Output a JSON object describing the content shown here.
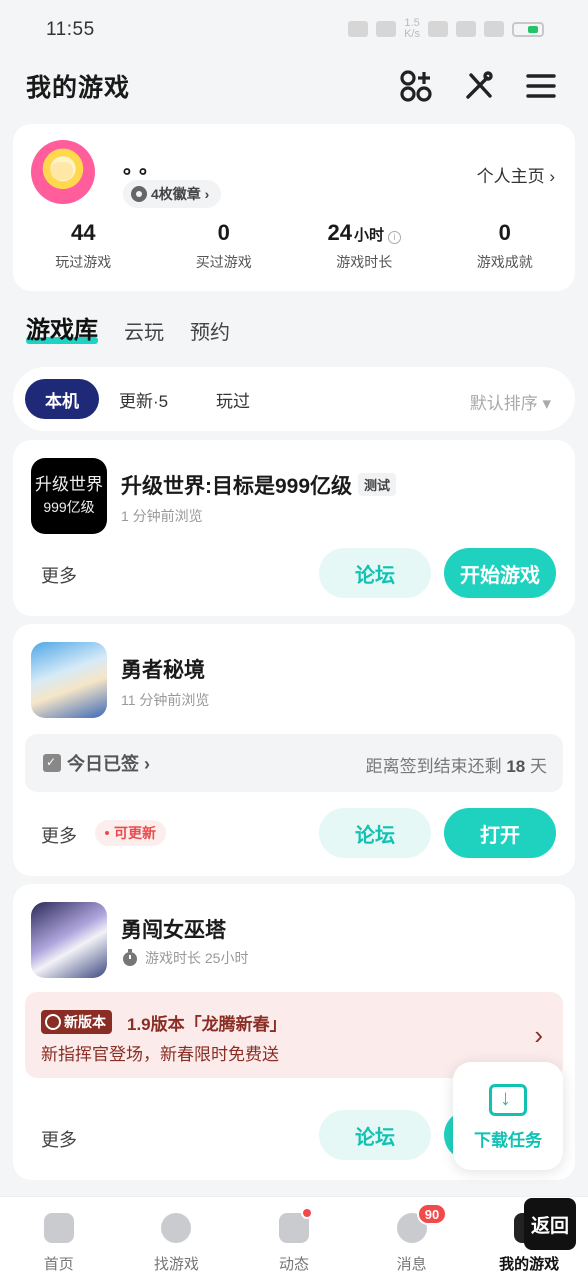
{
  "status": {
    "time": "11:55",
    "net_speed": "1.5\nK/s"
  },
  "header": {
    "title": "我的游戏"
  },
  "profile": {
    "nickname": "。。",
    "badges_label": "4枚徽章 ›",
    "home_link": "个人主页 ›",
    "stats": [
      {
        "value": "44",
        "unit": "",
        "label": "玩过游戏"
      },
      {
        "value": "0",
        "unit": "",
        "label": "买过游戏"
      },
      {
        "value": "24",
        "unit": "小时",
        "label": "游戏时长"
      },
      {
        "value": "0",
        "unit": "",
        "label": "游戏成就"
      }
    ]
  },
  "tabs": [
    "游戏库",
    "云玩",
    "预约"
  ],
  "filters": {
    "local": "本机",
    "update": "更新·5",
    "played": "玩过",
    "sort": "默认排序 ▾"
  },
  "games": [
    {
      "name": "升级世界:目标是999亿级",
      "tag": "测试",
      "icon_text_1": "升级世界",
      "icon_text_2": "999亿级",
      "sub": "1 分钟前浏览",
      "more": "更多",
      "forum": "论坛",
      "action": "开始游戏"
    },
    {
      "name": "勇者秘境",
      "sub": "11 分钟前浏览",
      "sign_left": "今日已签 ›",
      "sign_right_prefix": "距离签到结束还剩 ",
      "sign_right_days": "18",
      "sign_right_suffix": " 天",
      "more": "更多",
      "update_tag": "可更新",
      "forum": "论坛",
      "action": "打开"
    },
    {
      "name": "勇闯女巫塔",
      "sub": "游戏时长 25小时",
      "new_badge": "新版本",
      "new_title": "1.9版本「龙腾新春」",
      "new_desc": "新指挥官登场，新春限时免费送",
      "more": "更多",
      "forum": "论坛"
    }
  ],
  "float_download": {
    "label": "下载任务"
  },
  "bottom_nav": [
    {
      "label": "首页"
    },
    {
      "label": "找游戏"
    },
    {
      "label": "动态"
    },
    {
      "label": "消息",
      "count": "90"
    },
    {
      "label": "我的游戏"
    }
  ],
  "back_button": "返回",
  "colors": {
    "accent": "#1fd2bf",
    "accent_light": "#e5f8f6",
    "chip_active": "#1e2a78",
    "alert": "#e94b4b",
    "version_brown": "#8a2e25"
  }
}
